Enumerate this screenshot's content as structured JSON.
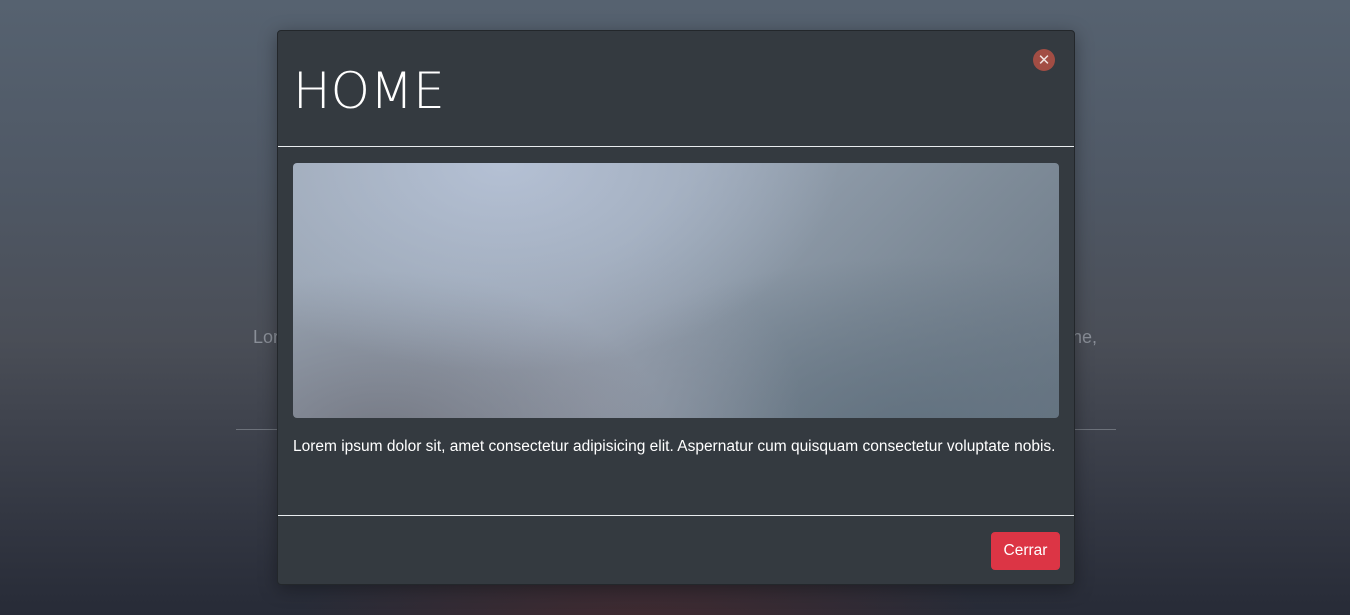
{
  "background": {
    "text_left_fragment": "Lor",
    "text_right_fragment": "ne,"
  },
  "modal": {
    "title": "HOME",
    "close_icon": "close-icon",
    "image_alt": "blurred landscape image",
    "description": "Lorem ipsum dolor sit, amet consectetur adipisicing elit. Aspernatur cum quisquam consectetur voluptate nobis.",
    "footer_button_label": "Cerrar"
  },
  "colors": {
    "modal_bg": "#343a40",
    "danger": "#dc3545",
    "close_icon_bg": "#a24d44",
    "text": "#ffffff"
  }
}
